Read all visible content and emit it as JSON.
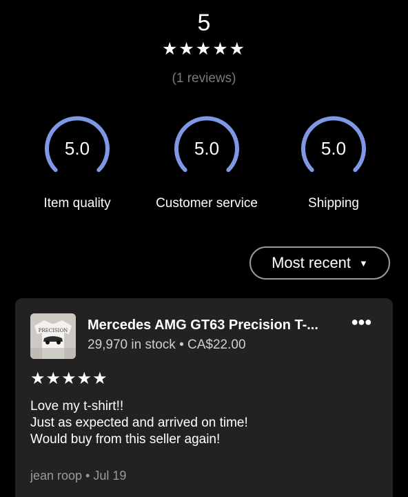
{
  "summary": {
    "overall_score": "5",
    "stars": "★★★★★",
    "rating": 5,
    "review_count_text": "(1 reviews)"
  },
  "metrics": [
    {
      "value": "5.0",
      "label": "Item quality"
    },
    {
      "value": "5.0",
      "label": "Customer service"
    },
    {
      "value": "5.0",
      "label": "Shipping"
    }
  ],
  "sort": {
    "label": "Most recent",
    "caret_icon": "caret-down-icon"
  },
  "review": {
    "product_title": "Mercedes AMG GT63 Precision T-...",
    "product_meta": "29,970 in stock • CA$22.00",
    "thumbnail_text": "PRECISION",
    "more_icon": "more-horizontal-icon",
    "stars": "★★★★★",
    "rating": 5,
    "text_lines": [
      "Love my t-shirt!!",
      "Just as expected and arrived on time!",
      "Would buy from this seller again!"
    ],
    "reviewer_line": "jean roop • Jul 19"
  },
  "colors": {
    "background": "#000000",
    "card": "#222222",
    "gauge_accent": "#7f98e6",
    "muted_text": "#9a9a9a"
  }
}
